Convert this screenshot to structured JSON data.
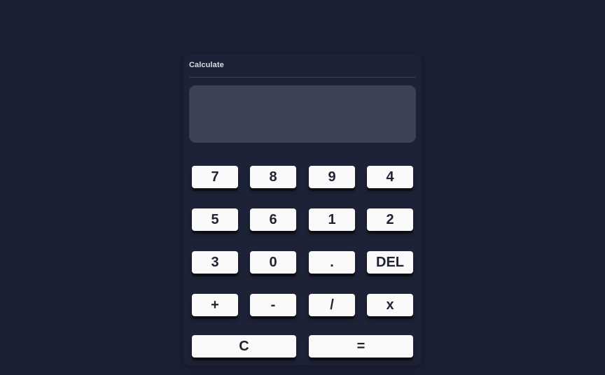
{
  "app": {
    "title": "Calculate"
  },
  "display": {
    "value": ""
  },
  "keys": {
    "k7": "7",
    "k8": "8",
    "k9": "9",
    "k4": "4",
    "k5": "5",
    "k6": "6",
    "k1": "1",
    "k2": "2",
    "k3": "3",
    "k0": "0",
    "dot": ".",
    "del": "DEL",
    "plus": "+",
    "minus": "-",
    "divide": "/",
    "multiply": "x",
    "clear": "C",
    "equals": "="
  },
  "colors": {
    "background": "#1b1f33",
    "card": "#1d2236",
    "display": "#3d4356",
    "key": "#fafafa",
    "key_text": "#1f2230",
    "title_text": "#d9dbe3"
  }
}
